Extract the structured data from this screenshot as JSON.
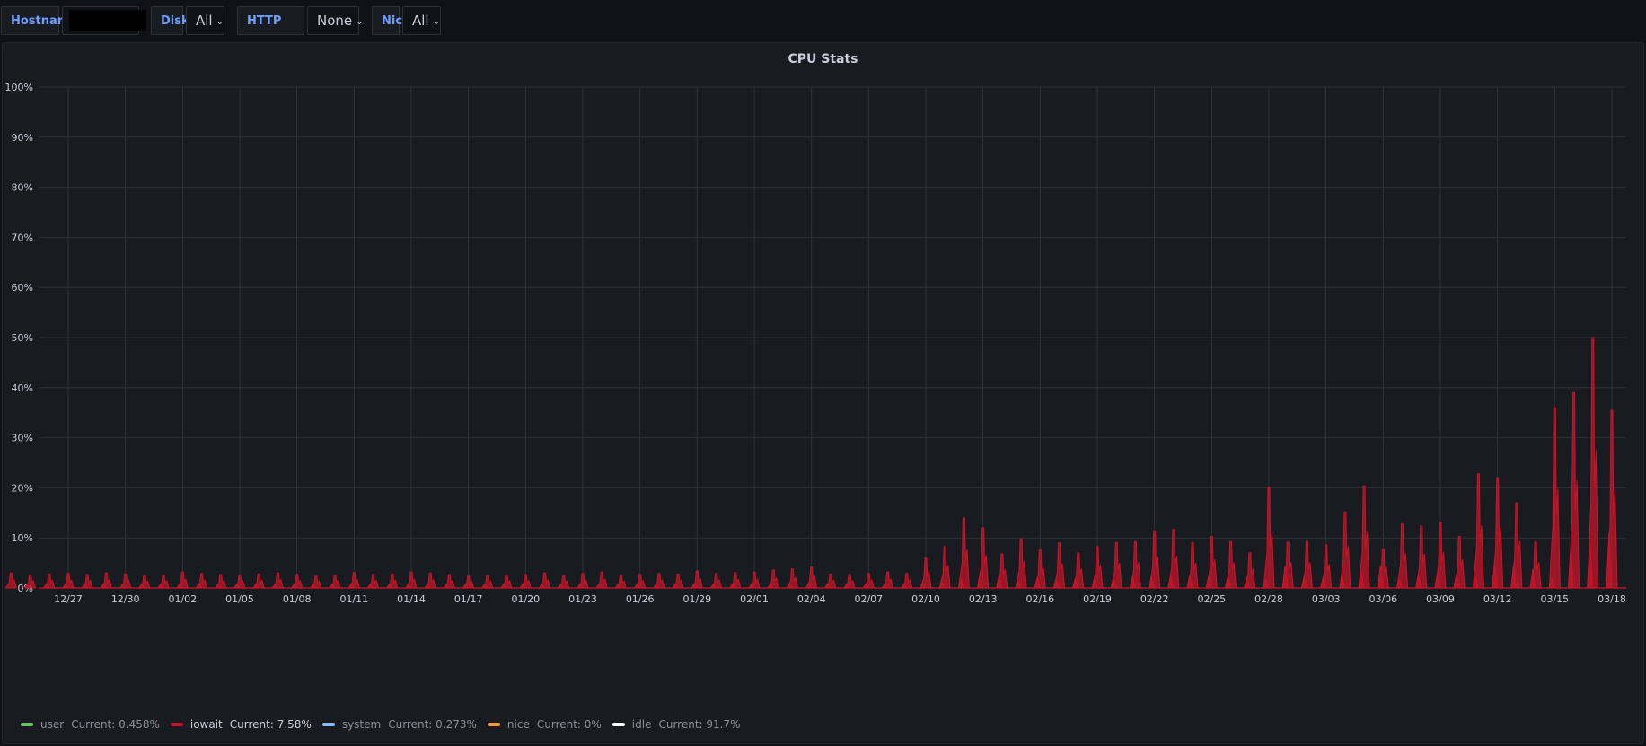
{
  "toolbar": {
    "hostname_label": "Hostname",
    "disk_label": "Disk",
    "disk_value": "All",
    "http_label": "HTTP Check",
    "http_value": "None",
    "nic_label": "Nic",
    "nic_value": "All",
    "chevron": "⌄"
  },
  "panel": {
    "title": "CPU Stats"
  },
  "legend": [
    {
      "name": "user",
      "current": "Current: 0.458%",
      "color": "#73bf69"
    },
    {
      "name": "iowait",
      "current": "Current: 7.58%",
      "color": "#c4162a"
    },
    {
      "name": "system",
      "current": "Current: 0.273%",
      "color": "#8ab8ff"
    },
    {
      "name": "nice",
      "current": "Current: 0%",
      "color": "#ff9830"
    },
    {
      "name": "idle",
      "current": "Current: 91.7%",
      "color": "#ffffff"
    }
  ],
  "chart_data": {
    "type": "area",
    "title": "CPU Stats",
    "x_ticks": [
      "12/27",
      "12/30",
      "01/02",
      "01/05",
      "01/08",
      "01/11",
      "01/14",
      "01/17",
      "01/20",
      "01/23",
      "01/26",
      "01/29",
      "02/01",
      "02/04",
      "02/07",
      "02/10",
      "02/13",
      "02/16",
      "02/19",
      "02/22",
      "02/25",
      "02/28",
      "03/03",
      "03/06",
      "03/09",
      "03/12",
      "03/15",
      "03/18"
    ],
    "y_ticks": [
      "0%",
      "10%",
      "20%",
      "30%",
      "40%",
      "50%",
      "60%",
      "70%",
      "80%",
      "90%",
      "100%"
    ],
    "ylim": [
      0,
      100
    ],
    "xlim": [
      "12/24",
      "03/18"
    ],
    "grid": true,
    "legend_placement": "bottom",
    "series": [
      {
        "name": "iowait",
        "color": "#c4162a",
        "daily_peaks": [
          {
            "date": "12/24",
            "value": 3
          },
          {
            "date": "12/25",
            "value": 2.6
          },
          {
            "date": "12/26",
            "value": 2.8
          },
          {
            "date": "12/27",
            "value": 2.9
          },
          {
            "date": "12/28",
            "value": 2.7
          },
          {
            "date": "12/29",
            "value": 3
          },
          {
            "date": "12/30",
            "value": 2.8
          },
          {
            "date": "12/31",
            "value": 2.5
          },
          {
            "date": "01/01",
            "value": 2.6
          },
          {
            "date": "01/02",
            "value": 3.2
          },
          {
            "date": "01/03",
            "value": 2.9
          },
          {
            "date": "01/04",
            "value": 2.7
          },
          {
            "date": "01/05",
            "value": 2.6
          },
          {
            "date": "01/06",
            "value": 2.8
          },
          {
            "date": "01/07",
            "value": 3
          },
          {
            "date": "01/08",
            "value": 2.7
          },
          {
            "date": "01/09",
            "value": 2.4
          },
          {
            "date": "01/10",
            "value": 2.6
          },
          {
            "date": "01/11",
            "value": 3.1
          },
          {
            "date": "01/12",
            "value": 2.7
          },
          {
            "date": "01/13",
            "value": 2.8
          },
          {
            "date": "01/14",
            "value": 3.2
          },
          {
            "date": "01/15",
            "value": 3
          },
          {
            "date": "01/16",
            "value": 2.7
          },
          {
            "date": "01/17",
            "value": 2.4
          },
          {
            "date": "01/18",
            "value": 2.5
          },
          {
            "date": "01/19",
            "value": 2.6
          },
          {
            "date": "01/20",
            "value": 2.7
          },
          {
            "date": "01/21",
            "value": 3
          },
          {
            "date": "01/22",
            "value": 2.5
          },
          {
            "date": "01/23",
            "value": 2.9
          },
          {
            "date": "01/24",
            "value": 3.2
          },
          {
            "date": "01/25",
            "value": 2.5
          },
          {
            "date": "01/26",
            "value": 2.7
          },
          {
            "date": "01/27",
            "value": 2.9
          },
          {
            "date": "01/28",
            "value": 2.8
          },
          {
            "date": "01/29",
            "value": 3.4
          },
          {
            "date": "01/30",
            "value": 2.9
          },
          {
            "date": "01/31",
            "value": 3.1
          },
          {
            "date": "02/01",
            "value": 3.2
          },
          {
            "date": "02/02",
            "value": 3.6
          },
          {
            "date": "02/03",
            "value": 3.8
          },
          {
            "date": "02/04",
            "value": 4.2
          },
          {
            "date": "02/05",
            "value": 2.8
          },
          {
            "date": "02/06",
            "value": 2.7
          },
          {
            "date": "02/07",
            "value": 2.9
          },
          {
            "date": "02/08",
            "value": 3.2
          },
          {
            "date": "02/09",
            "value": 2.9
          },
          {
            "date": "02/10",
            "value": 6
          },
          {
            "date": "02/11",
            "value": 8.3
          },
          {
            "date": "02/12",
            "value": 14
          },
          {
            "date": "02/13",
            "value": 12
          },
          {
            "date": "02/14",
            "value": 6.8
          },
          {
            "date": "02/15",
            "value": 9.8
          },
          {
            "date": "02/16",
            "value": 7.6
          },
          {
            "date": "02/17",
            "value": 9
          },
          {
            "date": "02/18",
            "value": 7
          },
          {
            "date": "02/19",
            "value": 8.3
          },
          {
            "date": "02/20",
            "value": 9.1
          },
          {
            "date": "02/21",
            "value": 9.3
          },
          {
            "date": "02/22",
            "value": 11.4
          },
          {
            "date": "02/23",
            "value": 11.7
          },
          {
            "date": "02/24",
            "value": 9.1
          },
          {
            "date": "02/25",
            "value": 10.3
          },
          {
            "date": "02/26",
            "value": 9.3
          },
          {
            "date": "02/27",
            "value": 7
          },
          {
            "date": "02/28",
            "value": 20.1
          },
          {
            "date": "03/01",
            "value": 9.2
          },
          {
            "date": "03/02",
            "value": 9.3
          },
          {
            "date": "03/03",
            "value": 8.6
          },
          {
            "date": "03/04",
            "value": 15.2
          },
          {
            "date": "03/05",
            "value": 20.4
          },
          {
            "date": "03/06",
            "value": 7.8
          },
          {
            "date": "03/07",
            "value": 12.8
          },
          {
            "date": "03/08",
            "value": 12.4
          },
          {
            "date": "03/09",
            "value": 13.1
          },
          {
            "date": "03/10",
            "value": 10.3
          },
          {
            "date": "03/11",
            "value": 22.8
          },
          {
            "date": "03/12",
            "value": 22
          },
          {
            "date": "03/13",
            "value": 17
          },
          {
            "date": "03/14",
            "value": 9.2
          },
          {
            "date": "03/15",
            "value": 36
          },
          {
            "date": "03/16",
            "value": 39
          },
          {
            "date": "03/17",
            "value": 50
          },
          {
            "date": "03/18",
            "value": 35.5
          }
        ]
      }
    ]
  }
}
